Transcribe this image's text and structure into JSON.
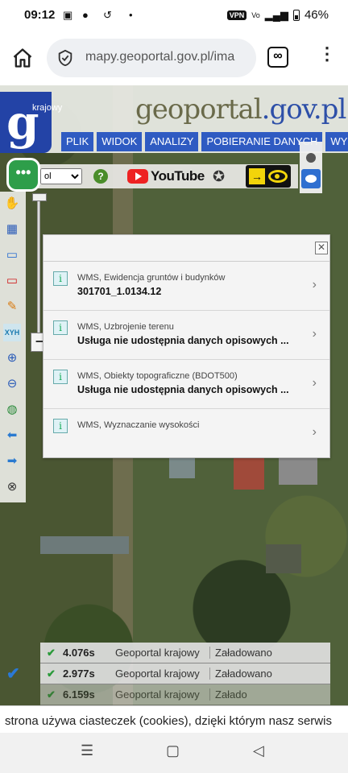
{
  "status_bar": {
    "time": "09:12",
    "vpn": "VPN",
    "battery": "46%"
  },
  "browser": {
    "url": "mapy.geoportal.gov.pl/ima"
  },
  "geoportal": {
    "small_label": "krajowy",
    "title_part1": "geoportal",
    "title_part2": ".gov.pl",
    "nav": [
      "PLIK",
      "WIDOK",
      "ANALIZY",
      "POBIERANIE DANYCH",
      "WY"
    ]
  },
  "toolbar": {
    "select_value": "ol",
    "youtube": "YouTube",
    "help": "?"
  },
  "fab": {
    "label": "•••"
  },
  "panel": {
    "rows": [
      {
        "title": "WMS, Ewidencja gruntów i budynków",
        "value": "301701_1.0134.12"
      },
      {
        "title": "WMS, Uzbrojenie terenu",
        "value": "Usługa nie udostępnia danych opisowych ..."
      },
      {
        "title": "WMS, Obiekty topograficzne (BDOT500)",
        "value": "Usługa nie udostępnia danych opisowych ..."
      },
      {
        "title": "WMS, Wyznaczanie wysokości",
        "value": ""
      }
    ]
  },
  "status_table": [
    {
      "time": "4.076s",
      "source": "Geoportal krajowy",
      "state": "Załadowano"
    },
    {
      "time": "2.977s",
      "source": "Geoportal krajowy",
      "state": "Załadowano"
    },
    {
      "time": "6.159s",
      "source": "Geoportal krajowy",
      "state": "Załado"
    }
  ],
  "cookie": {
    "text": "strona używa ciasteczek (cookies), dzięki którym nasz serwis"
  }
}
